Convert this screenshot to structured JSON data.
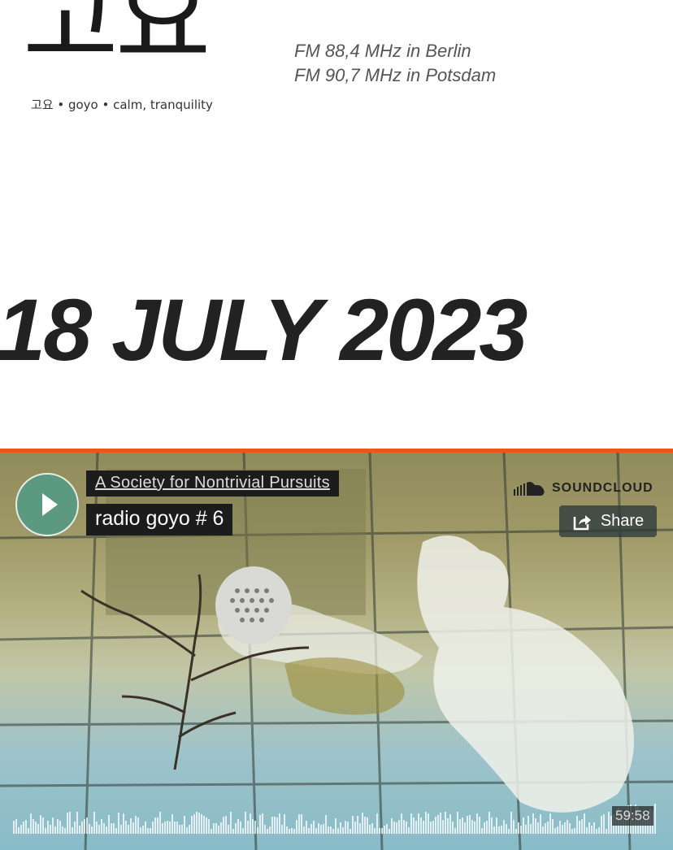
{
  "logo": {
    "hangul": "고요",
    "subtitle": "고요 • goyo • calm, tranquility"
  },
  "frequencies": [
    "FM 88,4 MHz in Berlin",
    "FM 90,7 MHz in Potsdam"
  ],
  "post": {
    "date": "18 JULY 2023"
  },
  "player": {
    "accent_color": "#f0541c",
    "play_button_color": "#5b9a80",
    "play_icon": "play-icon",
    "artist": "A Society for Nontrivial Pursuits",
    "title": "radio goyo # 6",
    "brand": "SOUNDCLOUD",
    "brand_icon": "soundcloud-icon",
    "share_label": "Share",
    "share_icon": "share-icon",
    "duration": "59:58"
  }
}
